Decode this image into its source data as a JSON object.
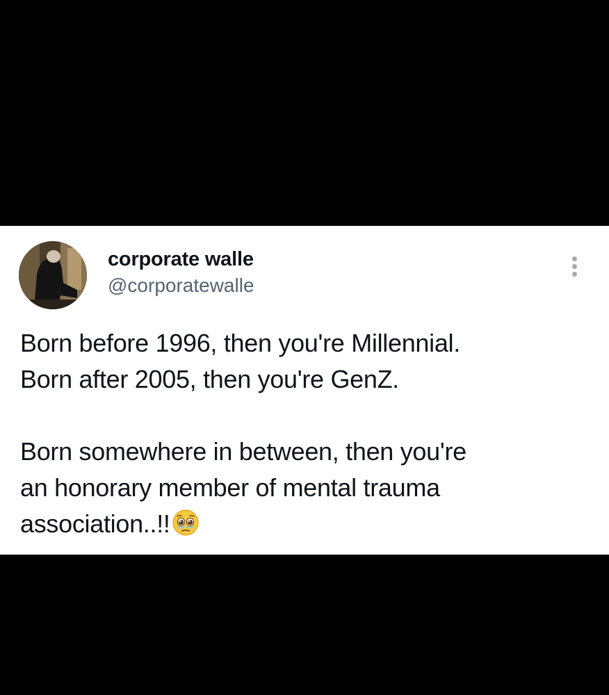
{
  "tweet": {
    "author": {
      "display_name": "corporate walle",
      "handle": "@corporatewalle",
      "avatar_icon": "profile-photo"
    },
    "more_icon": "more-vertical-icon",
    "text": {
      "line1": "Born before 1996, then you're Millennial.",
      "line2": "Born after 2005, then you're GenZ.",
      "line3": "Born somewhere in between, then you're",
      "line4": "an honorary member of mental trauma",
      "line5": "association..!!",
      "emoji": "pleading-face-emoji"
    }
  },
  "colors": {
    "background": "#000000",
    "card": "#ffffff",
    "text_primary": "#0f1419",
    "text_secondary": "#536471"
  }
}
